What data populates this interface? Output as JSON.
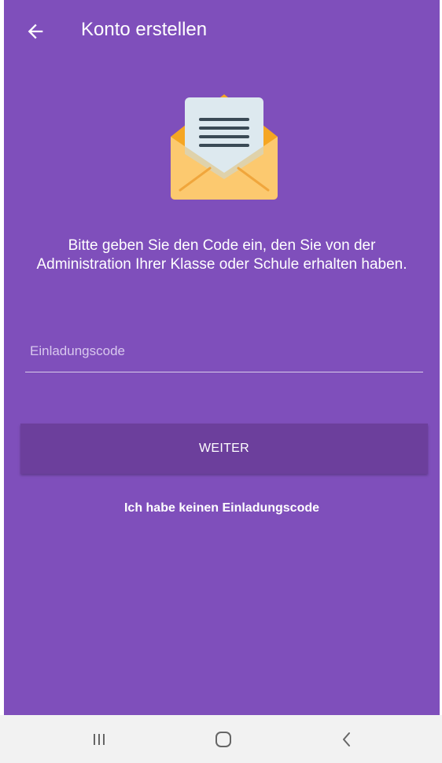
{
  "appbar": {
    "title": "Konto erstellen",
    "back_icon": "arrow-left-icon"
  },
  "illustration": {
    "icon": "open-envelope-letter-icon"
  },
  "message": "Bitte geben Sie den Code ein, den Sie von der Administration Ihrer Klasse oder Schule erhalten haben.",
  "form": {
    "code_placeholder": "Einladungscode",
    "code_value": "",
    "submit_label": "WEITER",
    "no_code_link": "Ich habe keinen Einladungscode"
  },
  "system_nav": {
    "recents_icon": "recents-icon",
    "home_icon": "home-icon",
    "back_icon": "system-back-icon"
  },
  "colors": {
    "background": "#7f4fbb",
    "button": "#6c3f9c",
    "nav_bar": "#f2f2f2"
  }
}
